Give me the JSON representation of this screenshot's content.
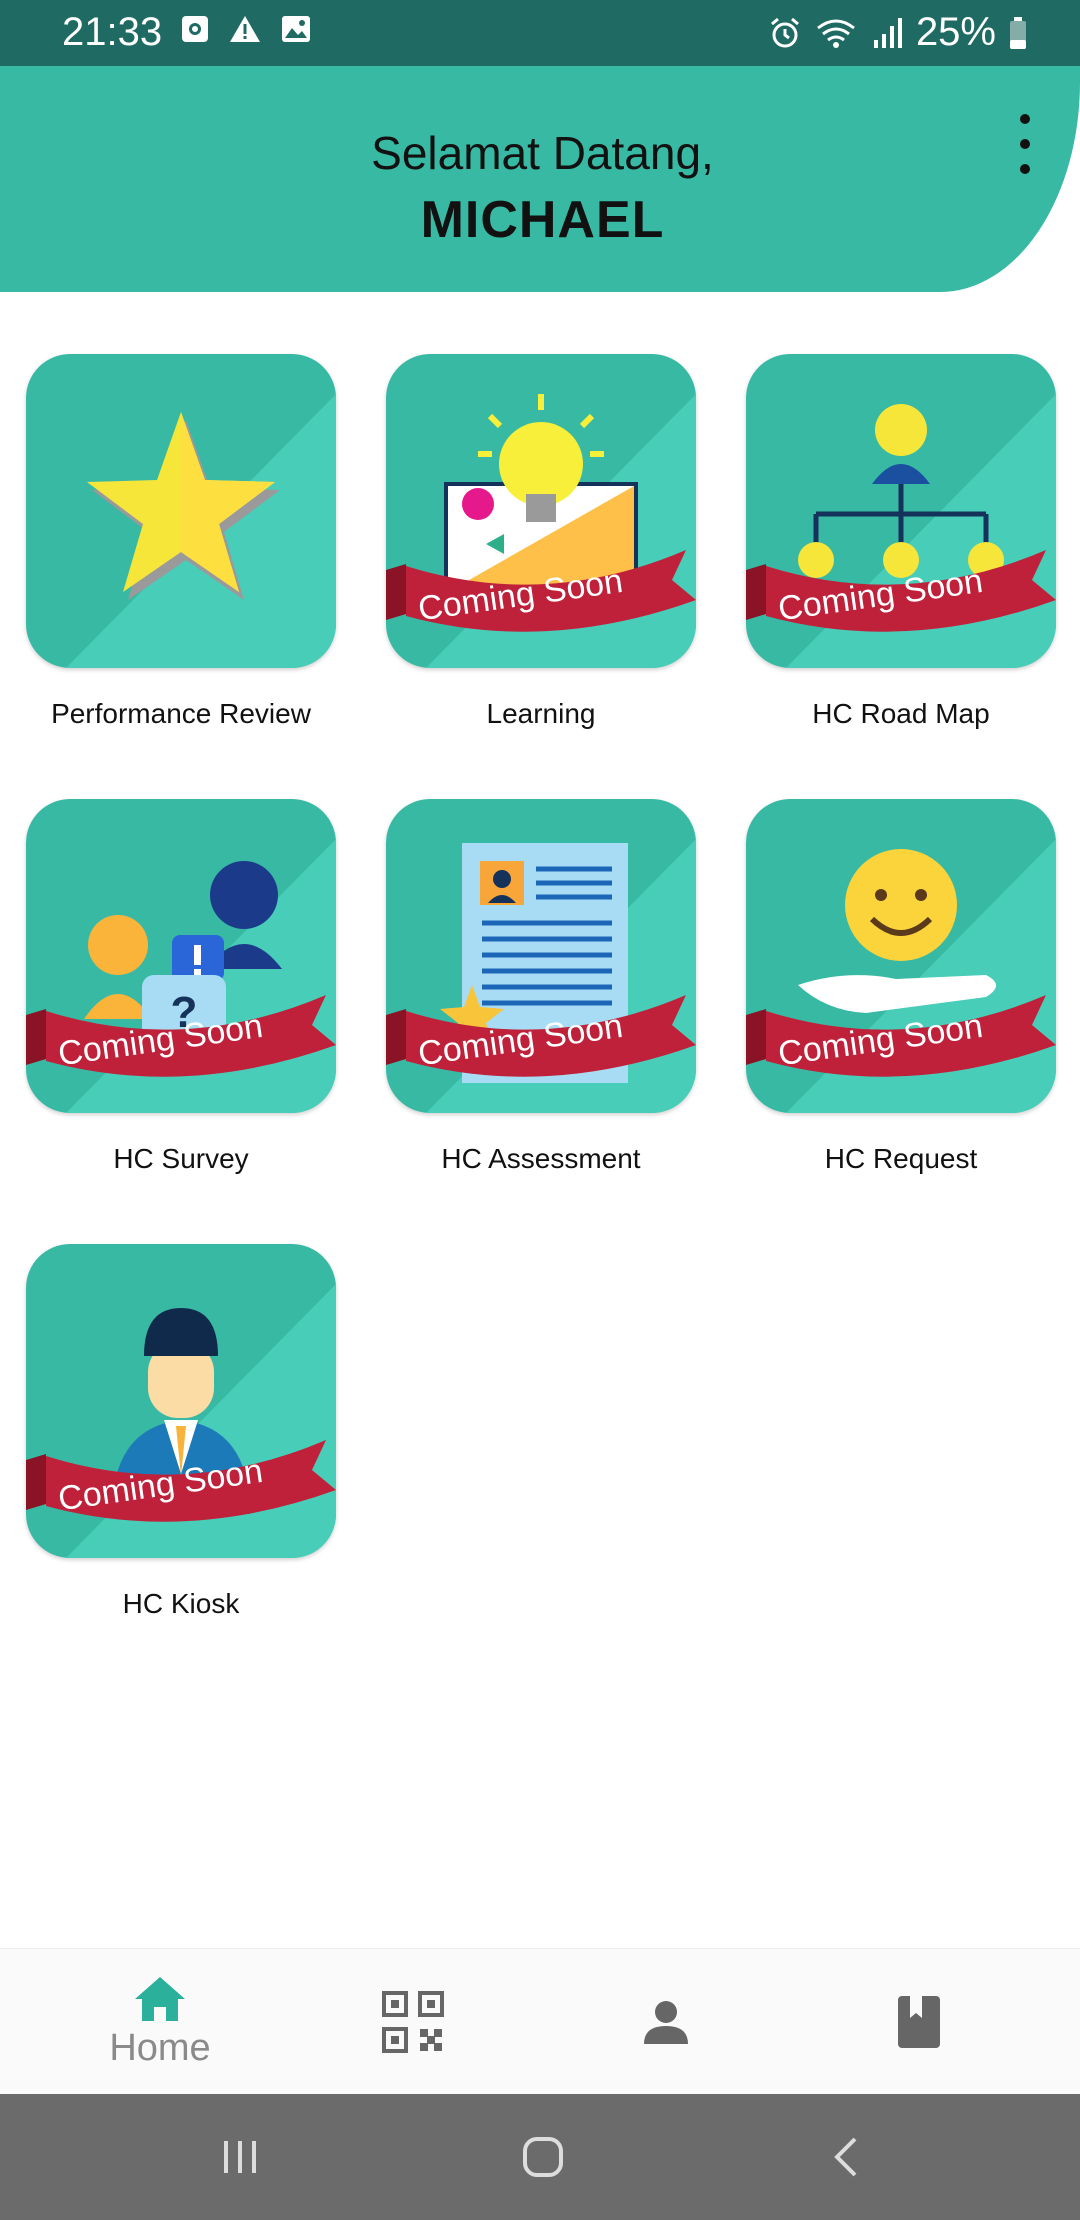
{
  "status_bar": {
    "time": "21:33",
    "battery": "25%"
  },
  "header": {
    "greeting": "Selamat Datang,",
    "username": "MICHAEL"
  },
  "tiles": [
    {
      "label": "Performance Review",
      "badge": ""
    },
    {
      "label": "Learning",
      "badge": "Coming Soon"
    },
    {
      "label": "HC Road Map",
      "badge": "Coming Soon"
    },
    {
      "label": "HC Survey",
      "badge": "Coming Soon"
    },
    {
      "label": "HC Assessment",
      "badge": "Coming Soon"
    },
    {
      "label": "HC Request",
      "badge": "Coming Soon"
    },
    {
      "label": "HC Kiosk",
      "badge": "Coming Soon"
    }
  ],
  "bottom_nav": {
    "home_label": "Home",
    "items": [
      "home-icon",
      "qr-code-icon",
      "person-icon",
      "book-icon"
    ]
  },
  "colors": {
    "header": "#38b9a4",
    "status_bar": "#1f6b63",
    "tile_bg": "#38b9a4",
    "ribbon": "#c0213a",
    "active_nav": "#2bb09c"
  }
}
